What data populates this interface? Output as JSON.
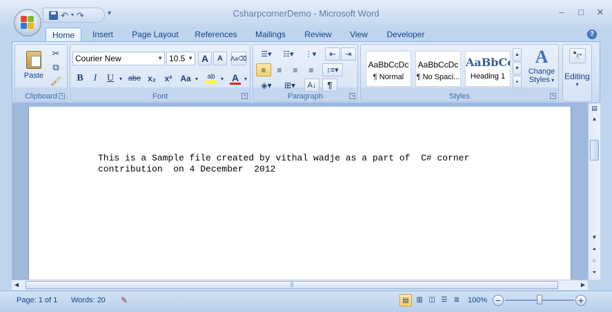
{
  "window": {
    "title": "CsharpcornerDemo - Microsoft Word",
    "controls": {
      "minimize": "–",
      "maximize": "□",
      "close": "✕"
    }
  },
  "quick_access": {
    "undo": "↶",
    "redo": "↷",
    "more": "▾"
  },
  "tabs": [
    "Home",
    "Insert",
    "Page Layout",
    "References",
    "Mailings",
    "Review",
    "View",
    "Developer"
  ],
  "active_tab": "Home",
  "help": "?",
  "ribbon": {
    "clipboard": {
      "label": "Clipboard",
      "paste": "Paste"
    },
    "font": {
      "label": "Font",
      "family": "Courier New",
      "size": "10.5",
      "grow": "A",
      "shrink": "A",
      "bold": "B",
      "italic": "I",
      "underline": "U",
      "strike": "abe",
      "subscript": "x₂",
      "superscript": "x²",
      "change_case": "Aa",
      "highlight": "ab",
      "font_color": "A"
    },
    "paragraph": {
      "label": "Paragraph",
      "pilcrow": "¶"
    },
    "styles": {
      "label": "Styles",
      "items": [
        {
          "sample": "AaBbCcDc",
          "name": "¶ Normal"
        },
        {
          "sample": "AaBbCcDc",
          "name": "¶ No Spaci..."
        },
        {
          "sample": "AaBbCc",
          "name": "Heading 1"
        }
      ],
      "change_styles_1": "Change",
      "change_styles_2": "Styles"
    },
    "editing": {
      "label": "Editing"
    }
  },
  "document": {
    "line1": "This is a Sample file created by vithal wadje as a part of  C# corner",
    "line2": "contribution  on 4 December  2012"
  },
  "status": {
    "page": "Page: 1 of 1",
    "words": "Words: 20",
    "zoom": "100%",
    "zoom_minus": "−",
    "zoom_plus": "+",
    "zoom_level_percent": 100
  },
  "colors": {
    "accent": "#15428b",
    "ribbon_bg": "#d2e1f3",
    "highlight_yellow": "#ffff00",
    "font_red": "#e02020"
  }
}
